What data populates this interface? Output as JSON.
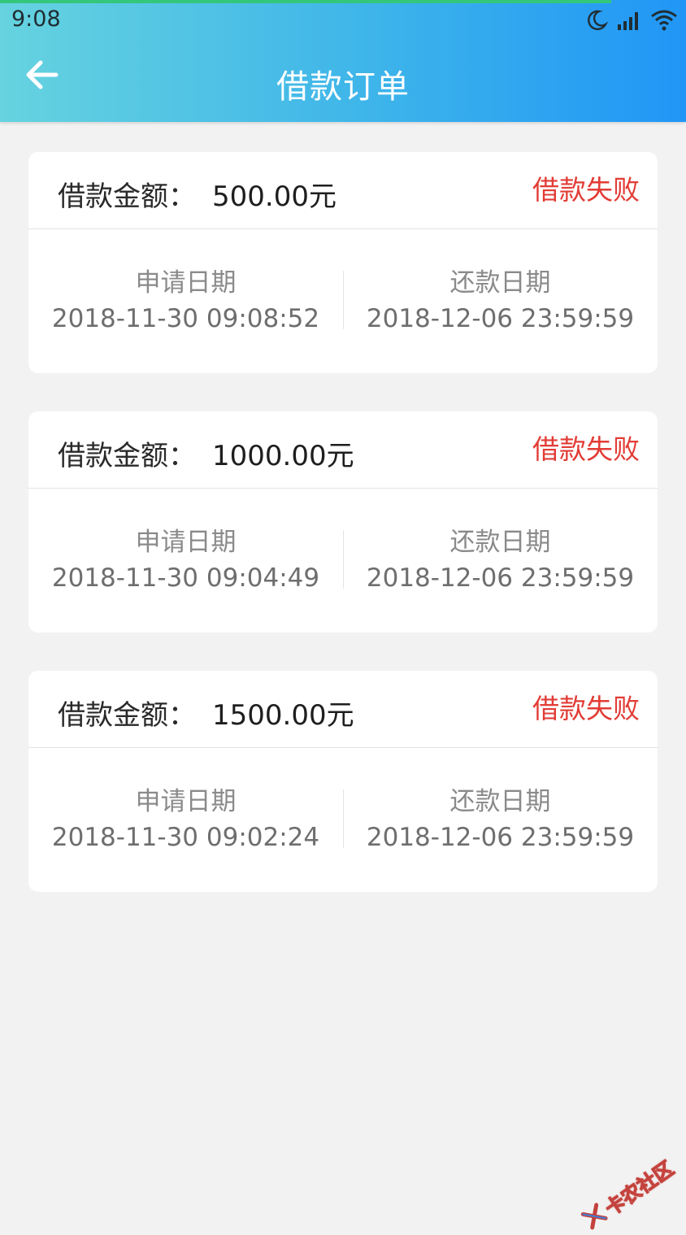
{
  "status_bar": {
    "time": "9:08",
    "icons": [
      "moon-icon",
      "signal-icon",
      "wifi-icon"
    ]
  },
  "header": {
    "back_icon": "arrow-left-icon",
    "title": "借款订单"
  },
  "colors": {
    "header_start": "#66d3df",
    "header_end": "#2196f6",
    "status_failed": "#e23c36",
    "background": "#f2f2f2"
  },
  "orders": [
    {
      "amount_label": "借款金额：",
      "amount": "500.00元",
      "status": "借款失败",
      "apply_label": "申请日期",
      "apply_date": "2018-11-30 09:08:52",
      "repay_label": "还款日期",
      "repay_date": "2018-12-06 23:59:59"
    },
    {
      "amount_label": "借款金额：",
      "amount": "1000.00元",
      "status": "借款失败",
      "apply_label": "申请日期",
      "apply_date": "2018-11-30 09:04:49",
      "repay_label": "还款日期",
      "repay_date": "2018-12-06 23:59:59"
    },
    {
      "amount_label": "借款金额：",
      "amount": "1500.00元",
      "status": "借款失败",
      "apply_label": "申请日期",
      "apply_date": "2018-11-30 09:02:24",
      "repay_label": "还款日期",
      "repay_date": "2018-12-06 23:59:59"
    }
  ],
  "watermark": {
    "text": "卡农社区"
  }
}
